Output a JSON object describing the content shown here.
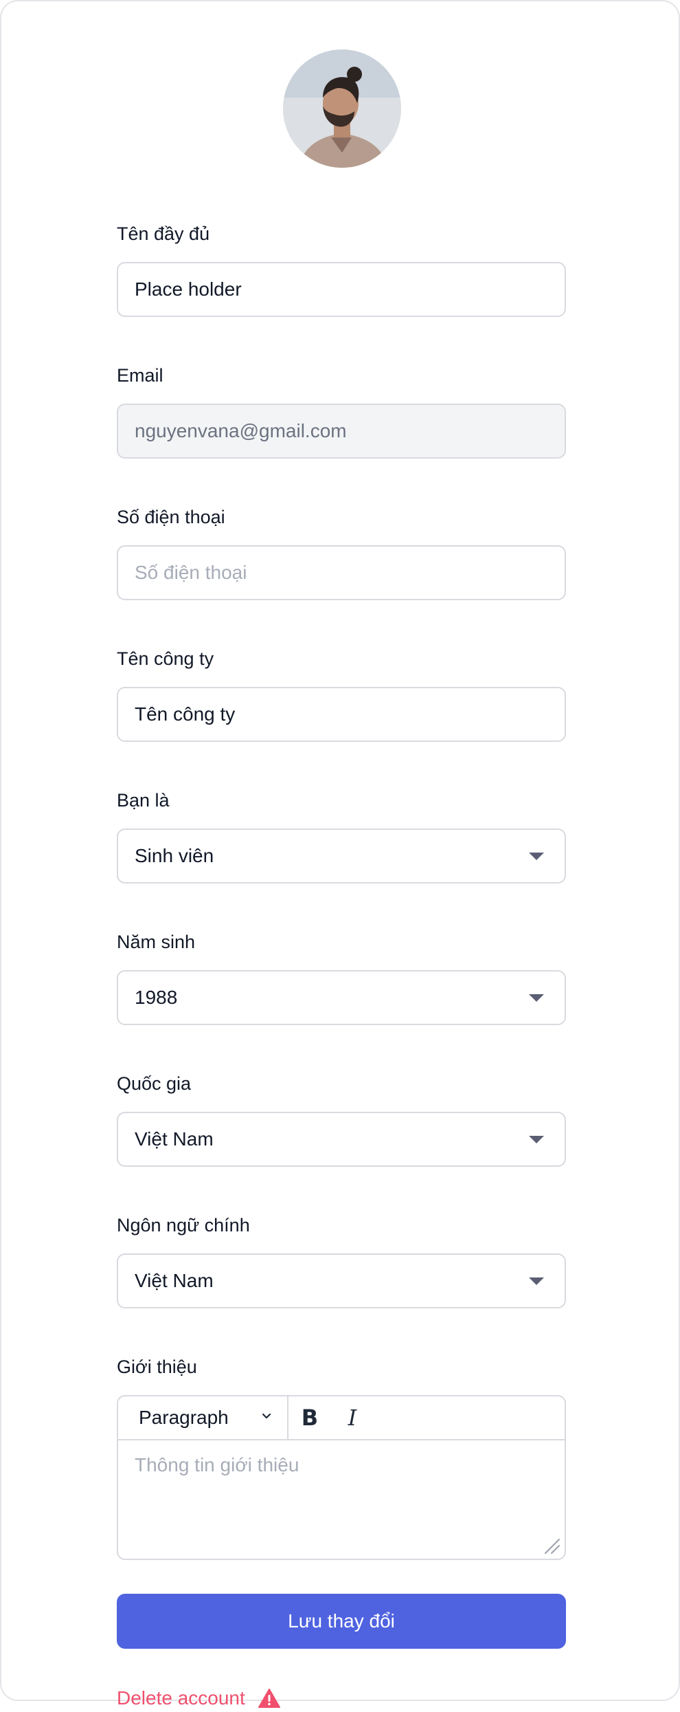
{
  "profile": {
    "avatar_alt": "User avatar"
  },
  "fields": {
    "full_name": {
      "label": "Tên đầy đủ",
      "value": "Place holder"
    },
    "email": {
      "label": "Email",
      "value": "nguyenvana@gmail.com"
    },
    "phone": {
      "label": "Số điện thoại",
      "placeholder": "Số điện thoại"
    },
    "company": {
      "label": "Tên công ty",
      "value": "Tên công ty"
    },
    "role": {
      "label": "Bạn là",
      "value": "Sinh viên"
    },
    "birth_year": {
      "label": "Năm sinh",
      "value": "1988"
    },
    "country": {
      "label": "Quốc gia",
      "value": "Việt Nam"
    },
    "language": {
      "label": "Ngôn ngữ chính",
      "value": "Việt Nam"
    },
    "bio": {
      "label": "Giới thiệu",
      "format_value": "Paragraph",
      "bold_label": "B",
      "italic_label": "I",
      "placeholder": "Thông tin giới thiệu"
    }
  },
  "actions": {
    "save_label": "Lưu thay đổi",
    "delete_label": "Delete account"
  },
  "colors": {
    "primary": "#4f63e0",
    "danger": "#f0506e",
    "border": "#d8dadf"
  }
}
